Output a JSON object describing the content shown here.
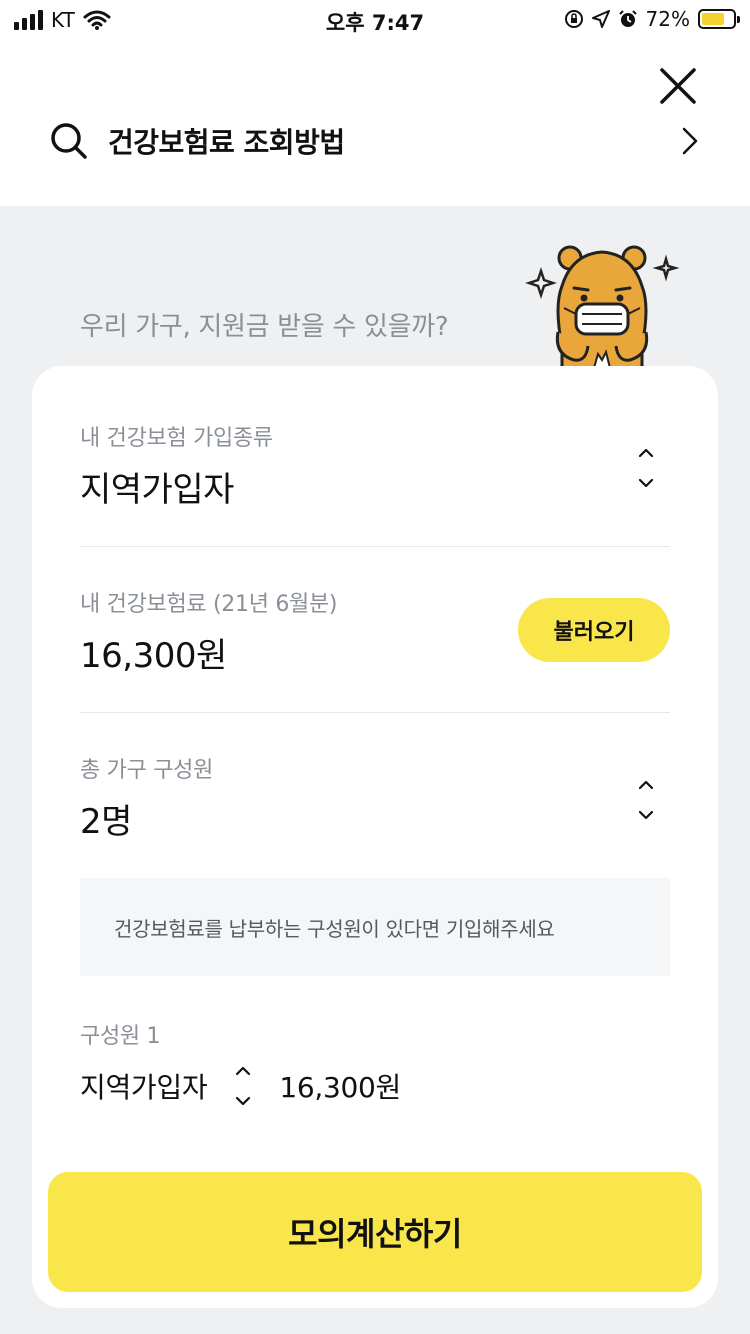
{
  "status_bar": {
    "carrier": "KT",
    "time": "오후 7:47",
    "battery_percent": "72%",
    "battery_level": 0.72,
    "icons": [
      "signal-icon",
      "wifi-icon",
      "orientation-lock-icon",
      "location-icon",
      "alarm-icon",
      "battery-charging-icon"
    ]
  },
  "header": {
    "close_icon": "close-icon",
    "search_icon": "search-icon",
    "search_query": "건강보험료 조회방법",
    "chevron_icon": "chevron-right-icon"
  },
  "banner": {
    "question": "우리 가구, 지원금 받을 수 있을까?"
  },
  "form": {
    "insurance_type": {
      "label": "내 건강보험 가입종류",
      "value": "지역가입자"
    },
    "premium": {
      "label": "내 건강보험료 (21년 6월분)",
      "value": "16,300원",
      "load_button": "불러오기"
    },
    "household": {
      "label": "총 가구 구성원",
      "value": "2명"
    },
    "notice": "건강보험료를 납부하는 구성원이 있다면 기입해주세요",
    "member1": {
      "label": "구성원 1",
      "type": "지역가입자",
      "amount": "16,300원"
    },
    "submit_label": "모의계산하기"
  },
  "colors": {
    "accent_yellow": "#f9e64b",
    "background": "#eef0f2",
    "muted_text": "#8b9097",
    "mascot_orange": "#e9a63a"
  }
}
